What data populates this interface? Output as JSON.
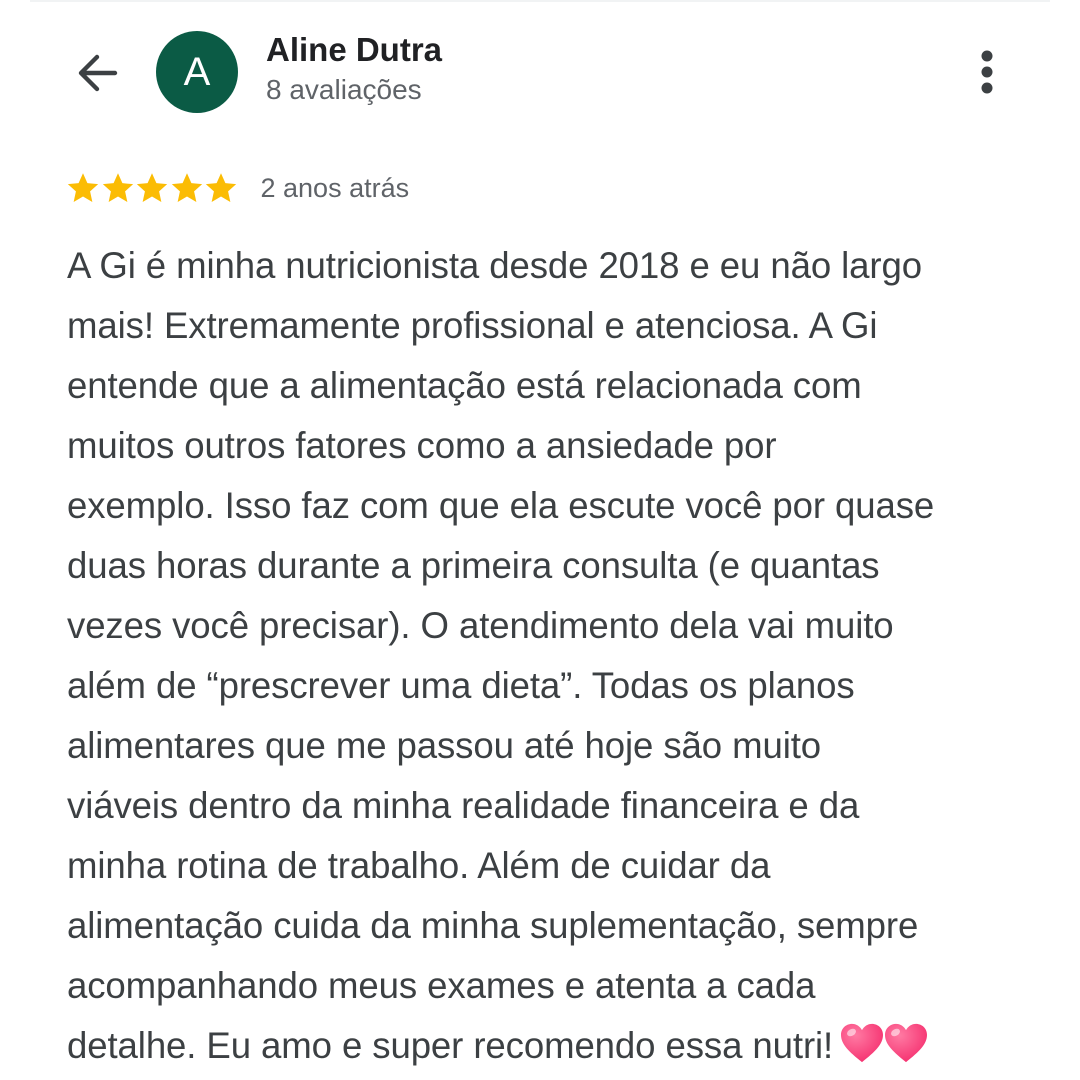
{
  "header": {
    "back_icon": "arrow-back-icon",
    "avatar_letter": "A",
    "avatar_color": "#0b5b45",
    "name": "Aline Dutra",
    "review_count": "8 avaliações",
    "more_icon": "more-vertical-icon"
  },
  "review": {
    "rating": 5,
    "rating_max": 5,
    "star_color": "#fbbc04",
    "date": "2 anos atrás",
    "text_lines": [
      "A Gi é minha nutricionista desde 2018 e eu não largo",
      "mais! Extremamente profissional e atenciosa. A Gi",
      "entende que a alimentação está relacionada com",
      "muitos outros fatores como a ansiedade por",
      "exemplo. Isso faz com que ela escute você por quase",
      "duas horas durante a primeira consulta (e quantas",
      "vezes você precisar). O atendimento dela vai muito",
      "além de “prescrever uma dieta”. Todas os planos",
      "alimentares que me passou até hoje são muito",
      "viáveis dentro da minha realidade financeira e da",
      "minha rotina de trabalho. Além de cuidar da",
      "alimentação cuida da minha suplementação, sempre",
      "acompanhando meus exames e atenta a cada",
      "detalhe. Eu amo e super recomendo essa nutri!"
    ],
    "emoji": "heart-emoji-icon",
    "emoji_count": 2,
    "emoji_color": "#f5306f"
  }
}
